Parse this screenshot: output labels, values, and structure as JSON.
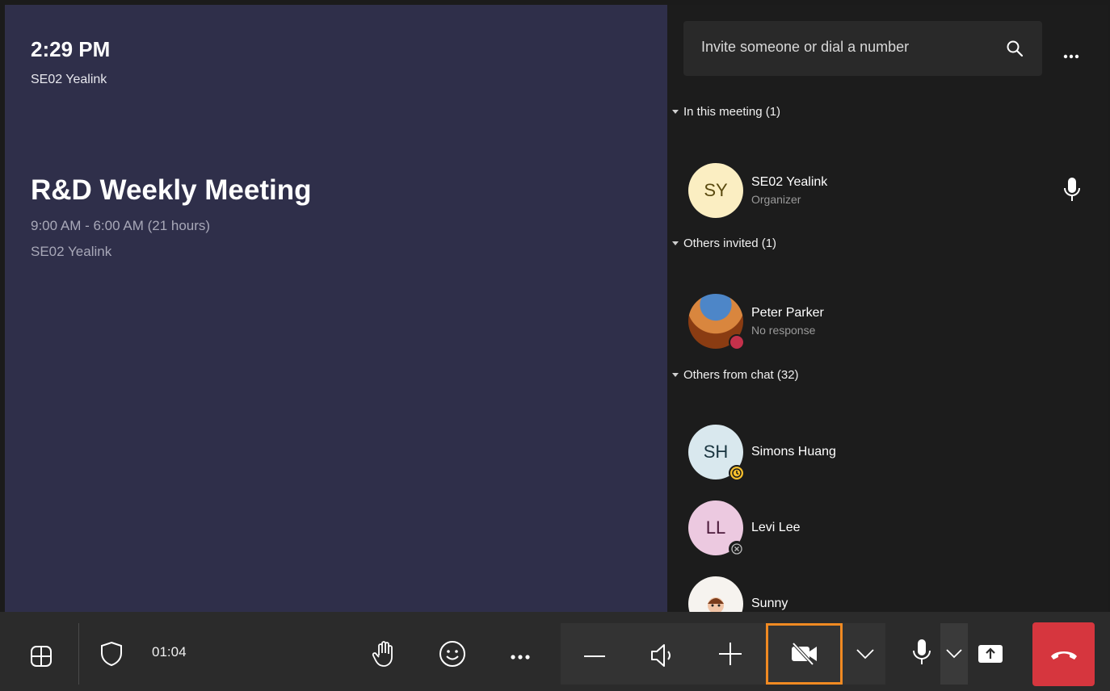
{
  "stage": {
    "clock": "2:29 PM",
    "device_name": "SE02 Yealink",
    "meeting_title": "R&D Weekly Meeting",
    "meeting_time": "9:00 AM - 6:00 AM (21 hours)",
    "meeting_organizer": "SE02 Yealink"
  },
  "panel": {
    "search_placeholder": "Invite someone or dial a number",
    "sections": {
      "in_meeting": "In this meeting (1)",
      "invited": "Others invited (1)",
      "from_chat": "Others from chat (32)"
    },
    "people": [
      {
        "initials": "SY",
        "name": "SE02 Yealink",
        "role": "Organizer"
      },
      {
        "initials": "",
        "name": "Peter Parker",
        "role": "No response"
      },
      {
        "initials": "SH",
        "name": "Simons Huang",
        "role": ""
      },
      {
        "initials": "LL",
        "name": "Levi Lee",
        "role": ""
      },
      {
        "initials": "",
        "name": "Sunny",
        "role": ""
      }
    ]
  },
  "bar": {
    "timer": "01:04"
  },
  "colors": {
    "stage_bg": "#2f2f4a",
    "panel_bg": "#1c1c1c",
    "bar_bg": "#2b2b2b",
    "highlight": "#f08a22",
    "end_call": "#d6363e",
    "status_busy": "#c4314b",
    "status_away": "#f8c02c"
  },
  "icons": [
    "search-icon",
    "more-icon",
    "mic-icon",
    "grid-icon",
    "shield-icon",
    "raise-hand-icon",
    "emoji-icon",
    "minus-icon",
    "speaker-icon",
    "plus-icon",
    "camera-off-icon",
    "chevron-down-icon",
    "share-icon",
    "hang-up-icon"
  ]
}
